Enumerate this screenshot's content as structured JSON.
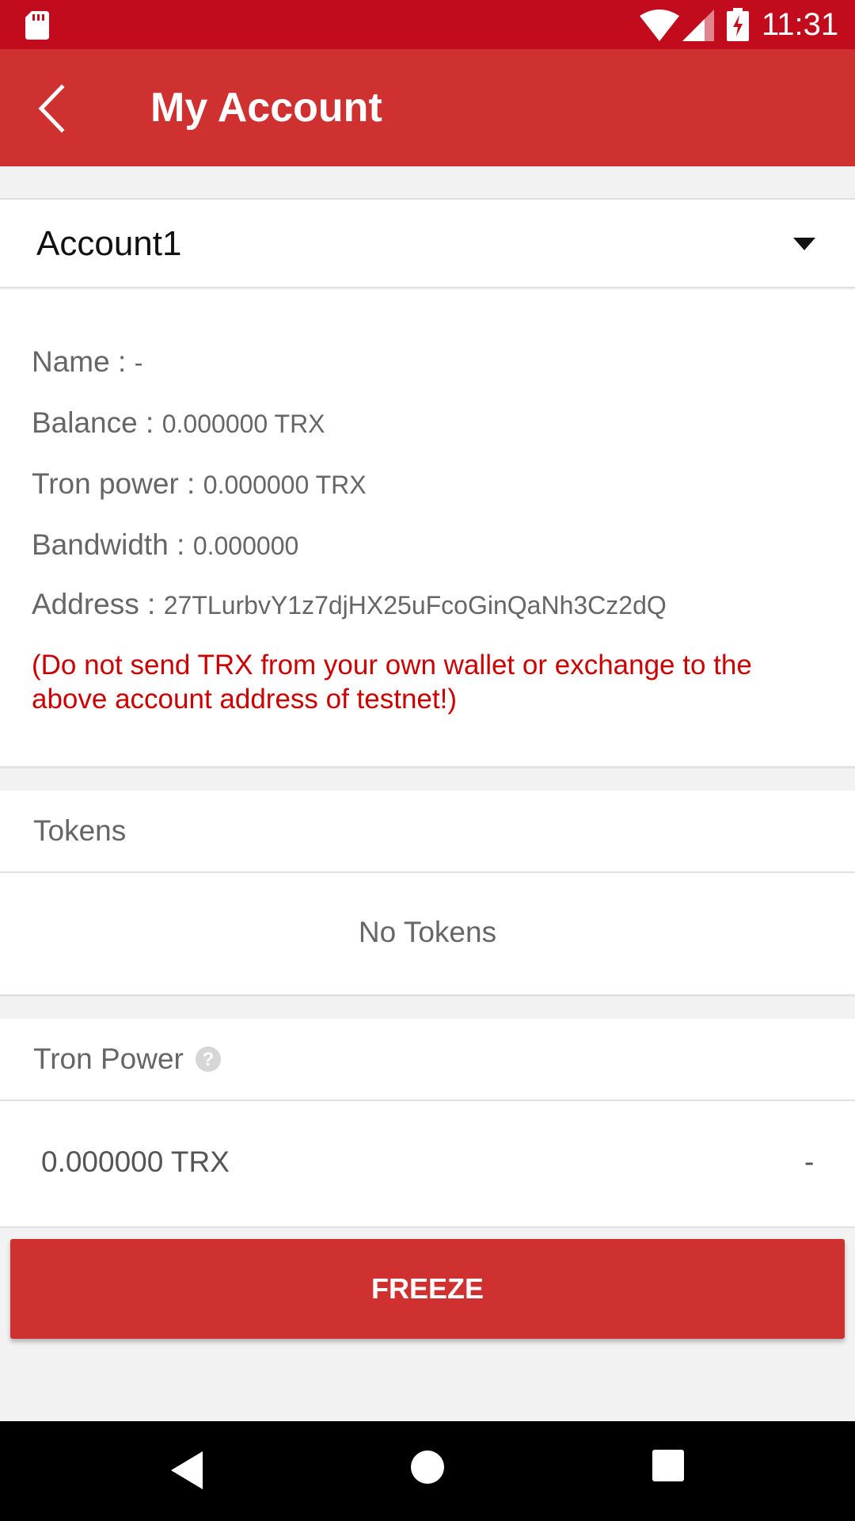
{
  "status_bar": {
    "time": "11:31",
    "icons": [
      "sd-card-icon",
      "wifi-icon",
      "signal-icon",
      "battery-charging-icon"
    ]
  },
  "header": {
    "title": "My Account",
    "back_icon": "chevron-left-icon"
  },
  "account_selector": {
    "selected": "Account1",
    "icon": "caret-down-icon"
  },
  "account_info": {
    "name_label": "Name :",
    "name_value": "-",
    "balance_label": "Balance :",
    "balance_value": "0.000000 TRX",
    "tron_power_label": "Tron power :",
    "tron_power_value": "0.000000 TRX",
    "bandwidth_label": "Bandwidth :",
    "bandwidth_value": "0.000000",
    "address_label": "Address :",
    "address_value": "27TLurbvY1z7djHX25uFcoGinQaNh3Cz2dQ",
    "warning_line1": "(Do not send TRX from your own wallet or exchange to the",
    "warning_line2": "above account address of testnet!)"
  },
  "tokens": {
    "header": "Tokens",
    "empty_text": "No Tokens"
  },
  "tron_power": {
    "header": "Tron Power",
    "help_icon": "question-circle-icon",
    "amount": "0.000000 TRX",
    "expiry": "-"
  },
  "actions": {
    "freeze_label": "FREEZE"
  },
  "nav_bar": {
    "icons": [
      "nav-back-icon",
      "nav-home-icon",
      "nav-recents-icon"
    ]
  },
  "colors": {
    "status_bar": "#c20c1e",
    "app_bar": "#cf3030",
    "warning_text": "#cc0000",
    "background": "#f2f2f2"
  }
}
